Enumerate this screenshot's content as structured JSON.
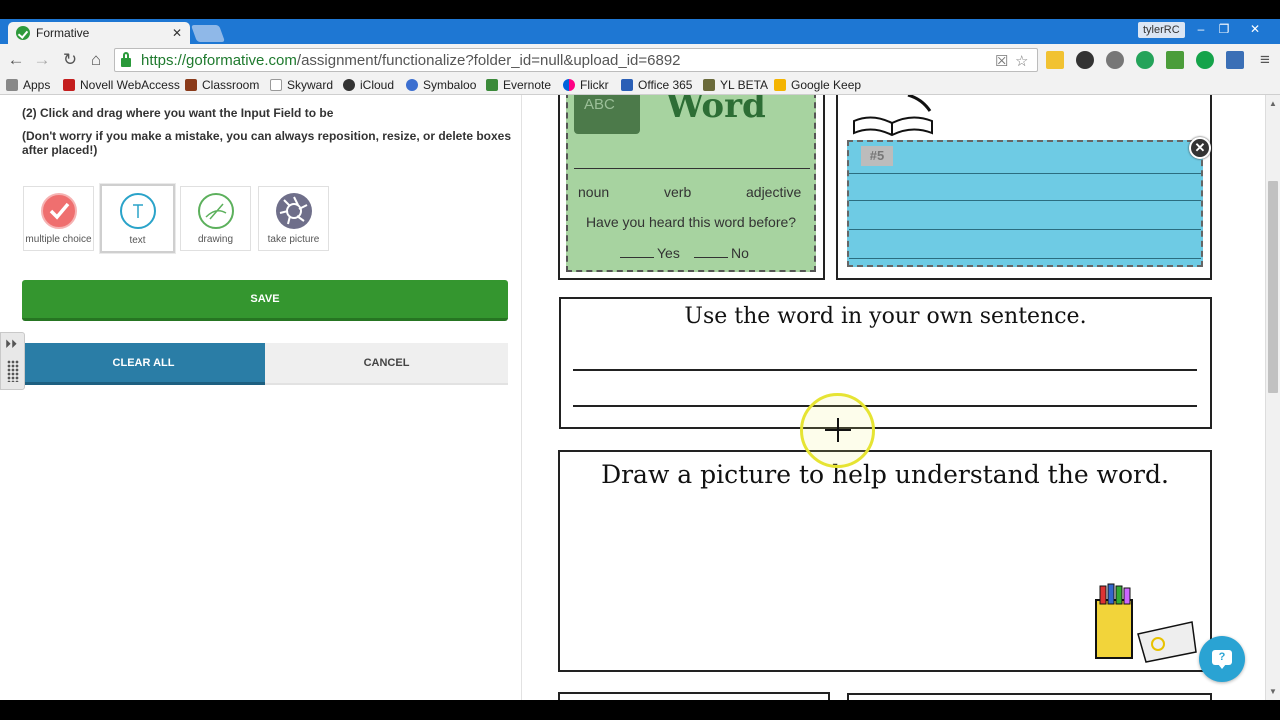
{
  "browser": {
    "tab_title": "Formative",
    "tab_close": "✕",
    "profile_name": "tylerRC",
    "window_minimize": "–",
    "window_restore": "❐",
    "window_close": "✕",
    "url_host": "https://goformative.com",
    "url_path": "/assignment/functionalize?folder_id=null&upload_id=6892",
    "bookmarks": [
      "Apps",
      "Novell WebAccess",
      "Classroom",
      "Skyward",
      "iCloud",
      "Symbaloo",
      "Evernote",
      "Flickr",
      "Office 365",
      "YL BETA",
      "Google Keep"
    ]
  },
  "editor": {
    "step_instruction": "(2) Click and drag where you want the Input Field to be",
    "hint": "(Don't worry if you make a mistake, you can always reposition, resize, or delete boxes after placed!)",
    "tools": [
      {
        "label": "multiple choice",
        "icon": "checkmark-icon",
        "color": "#e85858"
      },
      {
        "label": "text",
        "icon": "text-T-icon",
        "color": "#2aa3c9"
      },
      {
        "label": "drawing",
        "icon": "pencil-icon",
        "color": "#5cb05c"
      },
      {
        "label": "take picture",
        "icon": "camera-aperture-icon",
        "color": "#6f6f8a"
      }
    ],
    "save_label": "SAVE",
    "clear_label": "CLEAR ALL",
    "cancel_label": "CANCEL",
    "expand_glyph": "⏵⏵"
  },
  "worksheet": {
    "chalkboard_text": "ABC",
    "word_title": "Word",
    "parts_of_speech": [
      "noun",
      "verb",
      "adjective"
    ],
    "heard_question": "Have you heard this word before?",
    "yes_label": "Yes",
    "no_label": "No",
    "input_tag": "#5",
    "delete_glyph": "✕",
    "sentence_heading": "Use the word in your own sentence.",
    "draw_heading": "Draw a picture to help understand the word."
  },
  "colors": {
    "save_green": "#34962f",
    "clear_blue": "#2a7da6",
    "input_field_blue": "#6ecbe4",
    "word_box_green": "#a7d3a0",
    "help_blue": "#2aa3d3"
  }
}
